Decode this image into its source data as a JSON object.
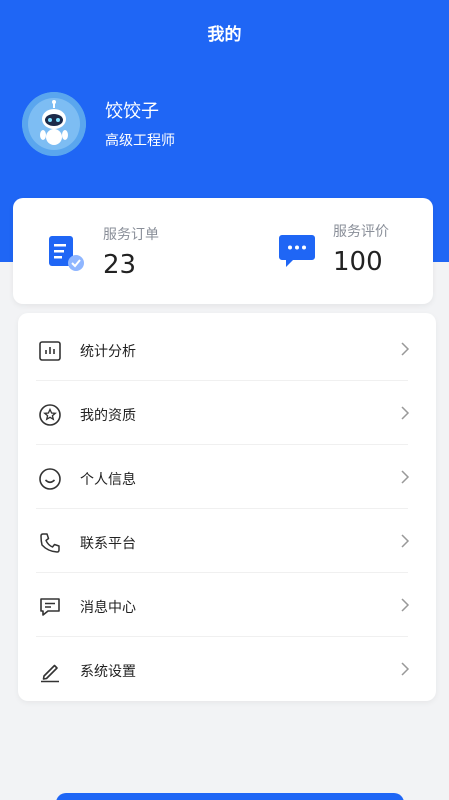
{
  "header": {
    "title": "我的"
  },
  "user": {
    "name": "饺饺子",
    "title": "高级工程师"
  },
  "stats": [
    {
      "label": "服务订单",
      "value": "23",
      "icon": "order-document-icon"
    },
    {
      "label": "服务评价",
      "value": "100",
      "icon": "chat-bubble-icon"
    }
  ],
  "menu": [
    {
      "label": "统计分析",
      "icon": "bar-chart-icon"
    },
    {
      "label": "我的资质",
      "icon": "star-circle-icon"
    },
    {
      "label": "个人信息",
      "icon": "smile-face-icon"
    },
    {
      "label": "联系平台",
      "icon": "phone-icon"
    },
    {
      "label": "消息中心",
      "icon": "message-icon"
    },
    {
      "label": "系统设置",
      "icon": "pen-icon"
    }
  ],
  "colors": {
    "primary": "#1f66f5",
    "background": "#f2f3f5",
    "card": "#ffffff"
  }
}
